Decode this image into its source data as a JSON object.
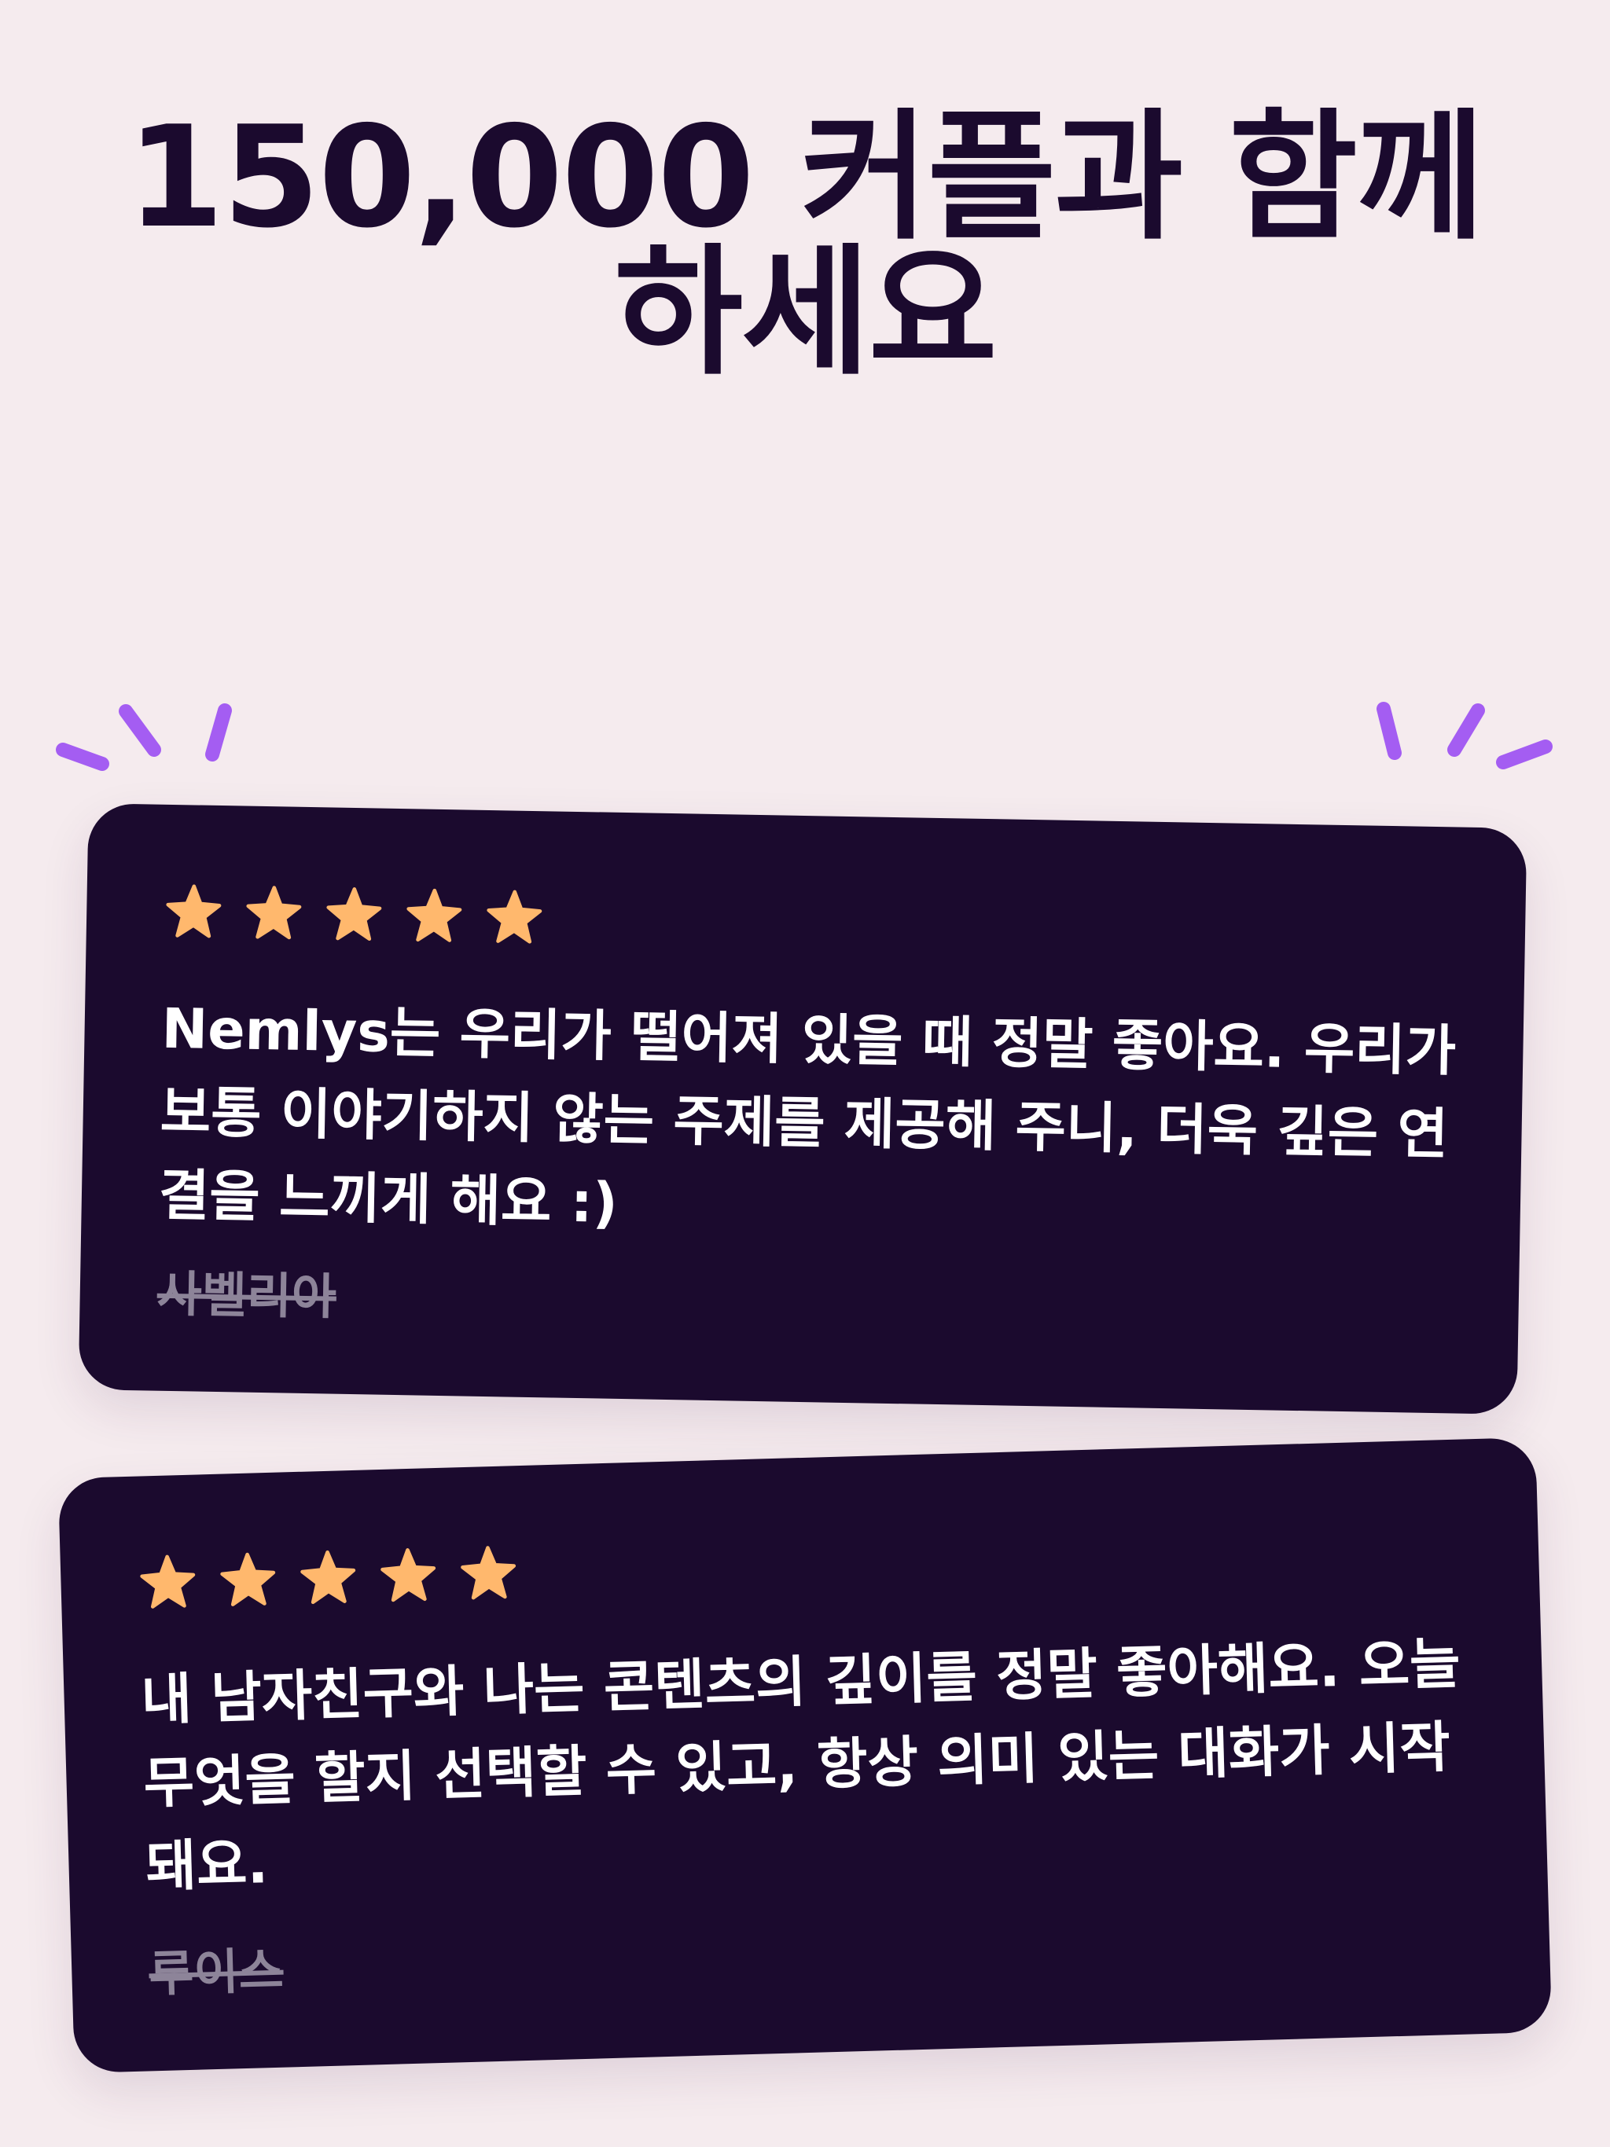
{
  "header": {
    "headline": "150,000 커플과 함께 하세요"
  },
  "reviews": [
    {
      "rating": 5,
      "text": "Nemlys는 우리가 떨어져 있을 때 정말 좋아요. 우리가 보통 이야기하지 않는 주제를 제공해 주니, 더욱 깊은 연결을 느끼게 해요 :)",
      "author": "사벨리아"
    },
    {
      "rating": 5,
      "text": "내 남자친구와 나는 콘텐츠의 깊이를 정말 좋아해요. 오늘 무엇을 할지 선택할 수 있고, 항상 의미 있는 대화가 시작돼요.",
      "author": "루이스"
    }
  ],
  "colors": {
    "background": "#f5ebee",
    "card": "#1b0a2e",
    "accent_sparkle": "#a45df2",
    "star": "#ffb86d",
    "text_primary": "#1b0a2e",
    "text_on_card": "#ffffff",
    "author": "#8d8499"
  }
}
